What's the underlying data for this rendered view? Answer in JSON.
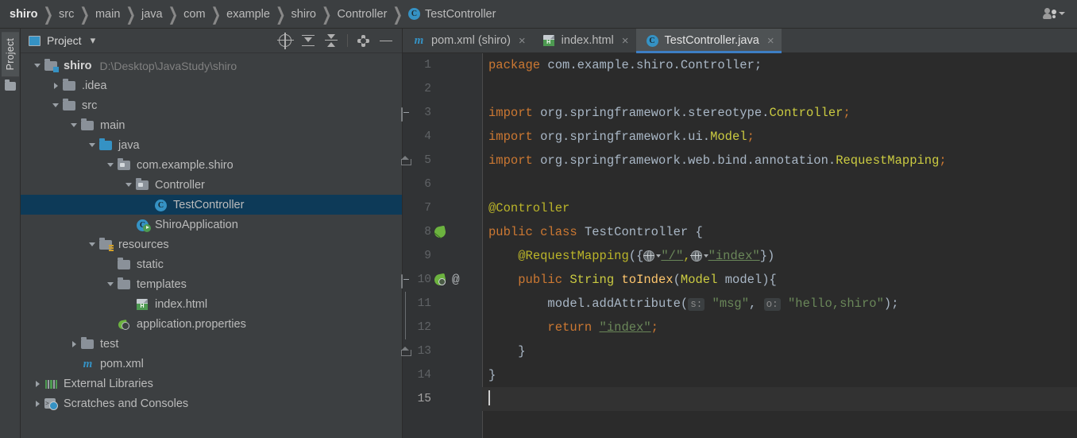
{
  "navbar": {
    "breadcrumbs": [
      {
        "label": "shiro",
        "icon": ""
      },
      {
        "label": "src",
        "icon": ""
      },
      {
        "label": "main",
        "icon": ""
      },
      {
        "label": "java",
        "icon": ""
      },
      {
        "label": "com",
        "icon": ""
      },
      {
        "label": "example",
        "icon": ""
      },
      {
        "label": "shiro",
        "icon": ""
      },
      {
        "label": "Controller",
        "icon": ""
      },
      {
        "label": "TestController",
        "icon": "class-icon"
      }
    ],
    "separator": "❯",
    "class_badge": "C",
    "account_icon": "account-icon"
  },
  "toolstrip": {
    "project_tab_label": "Project",
    "folder_icon": "folder-icon"
  },
  "project_panel": {
    "title": "Project",
    "caret": "▾",
    "tools": [
      {
        "name": "locate-in-tree-icon",
        "label": "Select Opened File"
      },
      {
        "name": "expand-all-icon",
        "label": "Expand All"
      },
      {
        "name": "collapse-all-icon",
        "label": "Collapse All"
      },
      {
        "name": "settings-gear-icon",
        "label": "Settings"
      },
      {
        "name": "hide-panel-icon",
        "label": "Hide"
      }
    ],
    "tree": [
      {
        "label": "shiro",
        "path": "D:\\Desktop\\JavaStudy\\shiro",
        "indent": 0,
        "arrow": "open",
        "icon": "module-folder-icon",
        "bold": true,
        "selected": false
      },
      {
        "label": ".idea",
        "indent": 1,
        "arrow": "closed",
        "icon": "folder-icon",
        "bold": false,
        "selected": false
      },
      {
        "label": "src",
        "indent": 1,
        "arrow": "open",
        "icon": "folder-icon",
        "bold": false,
        "selected": false
      },
      {
        "label": "main",
        "indent": 2,
        "arrow": "open",
        "icon": "folder-icon",
        "bold": false,
        "selected": false
      },
      {
        "label": "java",
        "indent": 3,
        "arrow": "open",
        "icon": "source-folder-icon",
        "bold": false,
        "selected": false
      },
      {
        "label": "com.example.shiro",
        "indent": 4,
        "arrow": "open",
        "icon": "package-icon",
        "bold": false,
        "selected": false
      },
      {
        "label": "Controller",
        "indent": 5,
        "arrow": "open",
        "icon": "package-icon",
        "bold": false,
        "selected": false
      },
      {
        "label": "TestController",
        "indent": 6,
        "arrow": "none",
        "icon": "java-class-icon",
        "bold": false,
        "selected": true
      },
      {
        "label": "ShiroApplication",
        "indent": 5,
        "arrow": "none",
        "icon": "spring-boot-app-icon",
        "bold": false,
        "selected": false
      },
      {
        "label": "resources",
        "indent": 3,
        "arrow": "open",
        "icon": "resource-folder-icon",
        "bold": false,
        "selected": false
      },
      {
        "label": "static",
        "indent": 4,
        "arrow": "none",
        "icon": "folder-icon",
        "bold": false,
        "selected": false
      },
      {
        "label": "templates",
        "indent": 4,
        "arrow": "open",
        "icon": "folder-icon",
        "bold": false,
        "selected": false
      },
      {
        "label": "index.html",
        "indent": 5,
        "arrow": "none",
        "icon": "html-file-icon",
        "bold": false,
        "selected": false
      },
      {
        "label": "application.properties",
        "indent": 4,
        "arrow": "none",
        "icon": "spring-properties-icon",
        "bold": false,
        "selected": false
      },
      {
        "label": "test",
        "indent": 2,
        "arrow": "closed",
        "icon": "folder-icon",
        "bold": false,
        "selected": false
      },
      {
        "label": "pom.xml",
        "indent": 2,
        "arrow": "none",
        "icon": "maven-icon",
        "bold": false,
        "selected": false
      },
      {
        "label": "External Libraries",
        "indent": 0,
        "arrow": "closed",
        "icon": "libraries-icon",
        "bold": false,
        "selected": false
      },
      {
        "label": "Scratches and Consoles",
        "indent": 0,
        "arrow": "closed",
        "icon": "scratches-icon",
        "bold": false,
        "selected": false
      }
    ]
  },
  "editor": {
    "tabs": [
      {
        "label": "pom.xml (shiro)",
        "icon": "maven-icon",
        "active": false,
        "close": "×"
      },
      {
        "label": "index.html",
        "icon": "html-file-icon",
        "active": false,
        "close": "×"
      },
      {
        "label": "TestController.java",
        "icon": "java-class-icon",
        "active": true,
        "close": "×"
      }
    ],
    "active_tab_accent": "#3d7ec4",
    "lines": [
      {
        "n": "1",
        "current": false,
        "gutter": [],
        "fold": "none"
      },
      {
        "n": "2",
        "current": false,
        "gutter": [],
        "fold": "none"
      },
      {
        "n": "3",
        "current": false,
        "gutter": [],
        "fold": "open"
      },
      {
        "n": "4",
        "current": false,
        "gutter": [],
        "fold": "none"
      },
      {
        "n": "5",
        "current": false,
        "gutter": [],
        "fold": "end"
      },
      {
        "n": "6",
        "current": false,
        "gutter": [],
        "fold": "none"
      },
      {
        "n": "7",
        "current": false,
        "gutter": [],
        "fold": "none"
      },
      {
        "n": "8",
        "current": false,
        "gutter": [
          "spring-bean-icon"
        ],
        "fold": "none"
      },
      {
        "n": "9",
        "current": false,
        "gutter": [],
        "fold": "none"
      },
      {
        "n": "10",
        "current": false,
        "gutter": [
          "spring-mapping-icon",
          "annotation-at-icon"
        ],
        "fold": "open"
      },
      {
        "n": "11",
        "current": false,
        "gutter": [],
        "fold": "tee"
      },
      {
        "n": "12",
        "current": false,
        "gutter": [],
        "fold": "tee"
      },
      {
        "n": "13",
        "current": false,
        "gutter": [],
        "fold": "end"
      },
      {
        "n": "14",
        "current": false,
        "gutter": [],
        "fold": "none"
      },
      {
        "n": "15",
        "current": true,
        "gutter": [],
        "fold": "none"
      }
    ],
    "code": {
      "l1_kw": "package",
      "l1_pkg": " com.example.shiro.Controller;",
      "l3_kw": "import",
      "l3_pkg": " org.springframework.stereotype.",
      "l3_cls": "Controller",
      "l3_end": ";",
      "l4_kw": "import",
      "l4_pkg": " org.springframework.ui.",
      "l4_cls": "Model",
      "l4_end": ";",
      "l5_kw": "import",
      "l5_pkg": " org.springframework.web.bind.annotation.",
      "l5_cls": "RequestMapping",
      "l5_end": ";",
      "l7_ann": "@Controller",
      "l8_kw1": "public",
      "l8_kw2": "class",
      "l8_name": "TestController",
      "l8_brace": "{",
      "l9_ann": "@RequestMapping",
      "l9_open": "({",
      "l9_s1": "\"/\"",
      "l9_comma": ",",
      "l9_s2": "\"index\"",
      "l9_close": "})",
      "l10_kw": "public",
      "l10_type": "String",
      "l10_name": "toIndex",
      "l10_p1": "(",
      "l10_ptype": "Model",
      "l10_pname": " model",
      "l10_p2": "){",
      "l11_obj": "model",
      "l11_dot": ".",
      "l11_mth": "addAttribute",
      "l11_open": "(",
      "l11_h1": "s:",
      "l11_a1": "\"msg\"",
      "l11_comma": ", ",
      "l11_h2": "o:",
      "l11_a2": "\"hello,shiro\"",
      "l11_close": ");",
      "l12_kw": "return",
      "l12_str": "\"index\"",
      "l12_end": ";",
      "l13_brace": "}",
      "l14_brace": "}"
    }
  }
}
